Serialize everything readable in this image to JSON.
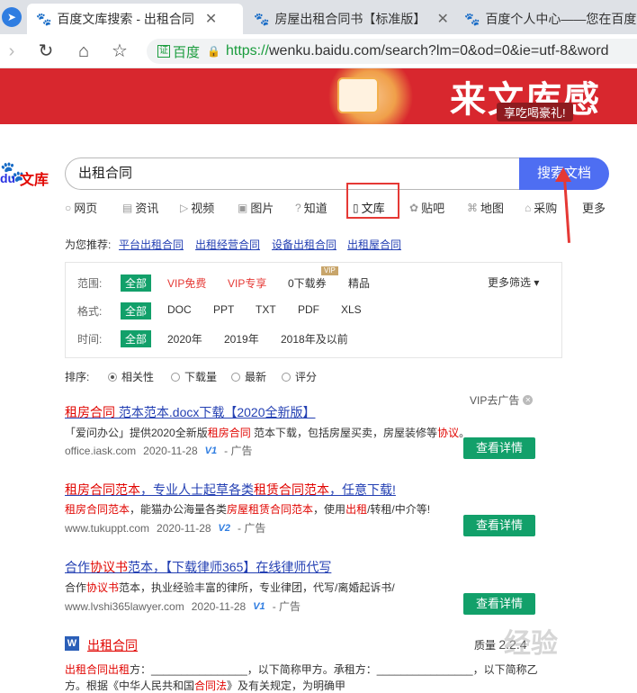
{
  "browser": {
    "tabs": [
      {
        "label": "百度文库搜索 - 出租合同"
      },
      {
        "label": "房屋出租合同书【标准版】"
      },
      {
        "label": "百度个人中心——您在百度"
      }
    ],
    "cert_label": "百度",
    "cert_box": "证",
    "url_https": "https://",
    "url_rest": "wenku.baidu.com/search?lm=0&od=0&ie=utf-8&word"
  },
  "banner": {
    "title": "来文库感恩季",
    "subtitle": "享吃喝豪礼!"
  },
  "logo": {
    "du": "du",
    "wenku": "文库"
  },
  "search": {
    "query": "出租合同",
    "button": "搜索文档"
  },
  "categories": [
    {
      "label": "网页",
      "icon": "search-icon"
    },
    {
      "label": "资讯",
      "icon": "news-icon"
    },
    {
      "label": "视频",
      "icon": "video-icon"
    },
    {
      "label": "图片",
      "icon": "image-icon"
    },
    {
      "label": "知道",
      "icon": "question-icon"
    },
    {
      "label": "文库",
      "icon": "document-icon"
    },
    {
      "label": "贴吧",
      "icon": "paw-icon"
    },
    {
      "label": "地图",
      "icon": "map-icon"
    },
    {
      "label": "采购",
      "icon": "shop-icon"
    },
    {
      "label": "更多",
      "icon": ""
    }
  ],
  "recommend": {
    "prefix": "为您推荐:",
    "links": [
      "平台出租合同",
      "出租经营合同",
      "设备出租合同",
      "出租屋合同"
    ]
  },
  "filters": {
    "range_label": "范围:",
    "range": [
      "全部",
      "VIP免费",
      "VIP专享",
      "0下载券",
      "精品"
    ],
    "vip_tag": "VIP",
    "format_label": "格式:",
    "format": [
      "全部",
      "DOC",
      "PPT",
      "TXT",
      "PDF",
      "XLS"
    ],
    "time_label": "时间:",
    "time": [
      "全部",
      "2020年",
      "2019年",
      "2018年及以前"
    ],
    "more": "更多筛选"
  },
  "sort": {
    "label": "排序:",
    "options": [
      "相关性",
      "下载量",
      "最新",
      "评分"
    ]
  },
  "vip_ad": "VIP去广告",
  "results": [
    {
      "title_hl": "租房合同",
      "title_rest": " 范本范本.docx下载【2020全新版】",
      "desc_a": "「爱问办公」提供2020全新版",
      "desc_hl": "租房合同",
      "desc_b": " 范本下载，包括房屋买卖，房屋装修等",
      "desc_hl2": "协议",
      "desc_c": "。",
      "site": "office.iask.com",
      "date": "2020-11-28",
      "badge": "V1",
      "ad": "- 广告",
      "button": "查看详情"
    },
    {
      "title_hl": "租房合同范本",
      "title_mid": "，专业人士起草各类",
      "title_hl2": "租赁合同范本",
      "title_rest": "，任意下载!",
      "desc_hl": "租房合同范本",
      "desc_b": "，能猫办公海量各类",
      "desc_hl2": "房屋租赁合同范本",
      "desc_c": "，使用",
      "desc_hl3": "出租",
      "desc_d": "/转租/中介等!",
      "site": "www.tukuppt.com",
      "date": "2020-11-28",
      "badge": "V2",
      "ad": "- 广告",
      "button": "查看详情"
    },
    {
      "title_pre": "合作",
      "title_hl": "协议书",
      "title_rest": "范本，【下载律师365】在线律师代写",
      "desc_a": "合作",
      "desc_hl": "协议书",
      "desc_b": "范本，执业经验丰富的律所，专业律团，代写/离婚起诉书/",
      "site": "www.lvshi365lawyer.com",
      "date": "2020-11-28",
      "badge": "V1",
      "ad": "- 广告",
      "button": "查看详情"
    }
  ],
  "doc_result": {
    "icon_letter": "W",
    "title": "出租合同",
    "quality_label": "质量",
    "quality_value": "2.2.4",
    "line1_hl": "出租合同出租",
    "line1": "方：________________，以下简称甲方。承租方：________________，以下简称乙",
    "line2_a": "方。根据《中华人民共和国",
    "line2_hl": "合同法",
    "line2_b": "》及有关规定，为明确甲",
    "watermark": "经验"
  }
}
